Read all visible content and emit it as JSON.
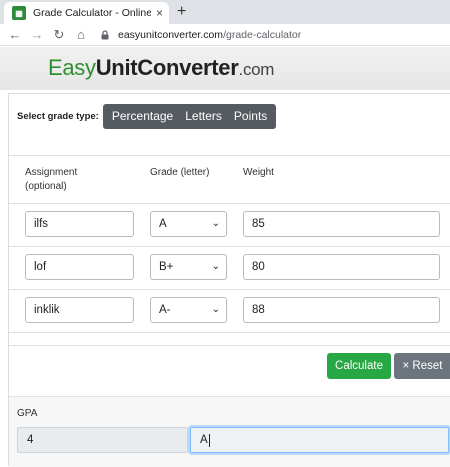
{
  "browser": {
    "tab_title": "Grade Calculator - Online Grade",
    "tab_close": "×",
    "new_tab": "+",
    "url_host": "easyunitconverter.com",
    "url_path": "/grade-calculator"
  },
  "site": {
    "logo_easy": "Easy",
    "logo_unit": "UnitConverter",
    "logo_com": ".com"
  },
  "calculator": {
    "type_label": "Select grade type:",
    "types": [
      "Percentage",
      "Letters",
      "Points"
    ],
    "headers": {
      "assignment": "Assignment",
      "assignment_note": "(optional)",
      "grade": "Grade (letter)",
      "weight": "Weight"
    },
    "rows": [
      {
        "assignment": "ilfs",
        "grade": "A",
        "weight": "85"
      },
      {
        "assignment": "lof",
        "grade": "B+",
        "weight": "80"
      },
      {
        "assignment": "inklik",
        "grade": "A-",
        "weight": "88"
      }
    ],
    "calculate_label": "Calculate",
    "reset_label": "× Reset",
    "gpa_label": "GPA",
    "gpa_value": "4",
    "letter_value": "A"
  },
  "colors": {
    "brand_green": "#2f8f2f",
    "calculate_green": "#28a745",
    "reset_gray": "#6c757d",
    "segment_dark": "#555b61"
  },
  "icons": {
    "back": "arrow-left-icon",
    "forward": "arrow-right-icon",
    "reload": "reload-icon",
    "home": "home-icon",
    "lock": "lock-icon",
    "select": "chevron-down-icon"
  }
}
